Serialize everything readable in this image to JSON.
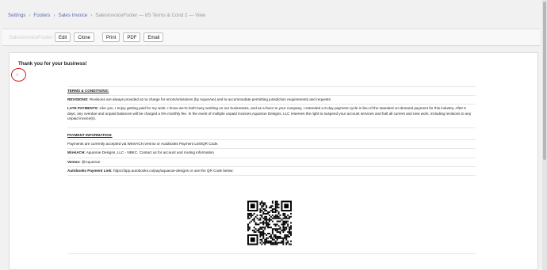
{
  "breadcrumb": {
    "items": [
      "Settings",
      "Footers",
      "Sales Invoice"
    ],
    "current": "SalesInvoiceFooter — 8S Terms & Cond 2 — View"
  },
  "toolbar": {
    "title": "SalesInvoiceFooter",
    "buttons": [
      "Edit",
      "Clone",
      "Print",
      "PDF",
      "Email"
    ]
  },
  "footer": {
    "thank_you": "Thank you for your business!",
    "annotation_mark": "/",
    "terms_heading": "TERMS & CONDITIONS:",
    "revisions_label": "REVISIONS:",
    "revisions_text": " Revisions are always provided at no charge for errors/omissions (by AquaVue) and to accommodate permitting jurisdiction requirements and requests.",
    "late_label": "LATE PAYMENTS:",
    "late_text": " Like you, I enjoy getting paid for my work. I know we're both busy working on our businesses, and as a favor to your company, I extended a 5-day payment cycle in lieu of the standard on-demand payment for this industry. After 5 days, any overdue and unpaid balances will be charged a 5% monthly fee. In the event of multiple unpaid invoices,AquaVue Designs, LLC reserves the right to suspend your account services and halt all current and new work, including revisions to any unpaid invoice(s).",
    "payment_heading": "PAYMENT INFORMATION:",
    "payment_methods": "Payments are currently accepted via Wire/ACH,Venmo or Autobooks Payment Link/QR Code.",
    "wire_label": "Wire/ACH:",
    "wire_text": " AquaVue Designs, LLC - NBKC. Contact us for account and routing information",
    "venmo_label": "Venmo:",
    "venmo_text": " @AquaVue",
    "autobooks_label": "Autobooks Payment Link:",
    "autobooks_text": " https://app.autobooks.co/pay/aquavue-designs or use the QR Code below:"
  },
  "colors": {
    "link": "#5a6fb0",
    "annotation": "#d21a1a"
  },
  "icons": {
    "qr_code": "qr-code-icon"
  }
}
